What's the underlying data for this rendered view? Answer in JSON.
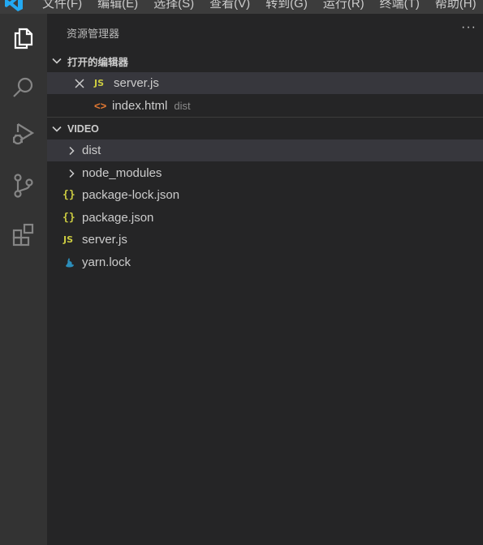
{
  "menubar": {
    "items": [
      "文件(F)",
      "编辑(E)",
      "选择(S)",
      "查看(V)",
      "转到(G)",
      "运行(R)",
      "终端(T)",
      "帮助(H)"
    ]
  },
  "activity_bar": {
    "icons": [
      "explorer-icon",
      "search-icon",
      "run-debug-icon",
      "source-control-icon",
      "extensions-icon"
    ]
  },
  "sidebar": {
    "title": "资源管理器",
    "more": "···",
    "open_editors": {
      "label": "打开的编辑器",
      "items": [
        {
          "name": "server.js",
          "icon_text": "JS",
          "description": ""
        },
        {
          "name": "index.html",
          "icon_text": "<>",
          "description": "dist"
        }
      ]
    },
    "folder": {
      "label": "VIDEO",
      "items": [
        {
          "name": "dist",
          "type": "folder"
        },
        {
          "name": "node_modules",
          "type": "folder"
        },
        {
          "name": "package-lock.json",
          "type": "json",
          "icon_text": "{}"
        },
        {
          "name": "package.json",
          "type": "json",
          "icon_text": "{}"
        },
        {
          "name": "server.js",
          "type": "js",
          "icon_text": "JS"
        },
        {
          "name": "yarn.lock",
          "type": "yarn"
        }
      ]
    }
  },
  "colors": {
    "sidebar_bg": "#252526",
    "activity_bg": "#333333",
    "selection_bg": "#37373d",
    "js_yellow": "#cbcb41",
    "html_orange": "#e37933",
    "yarn_blue": "#2c8ebb"
  }
}
